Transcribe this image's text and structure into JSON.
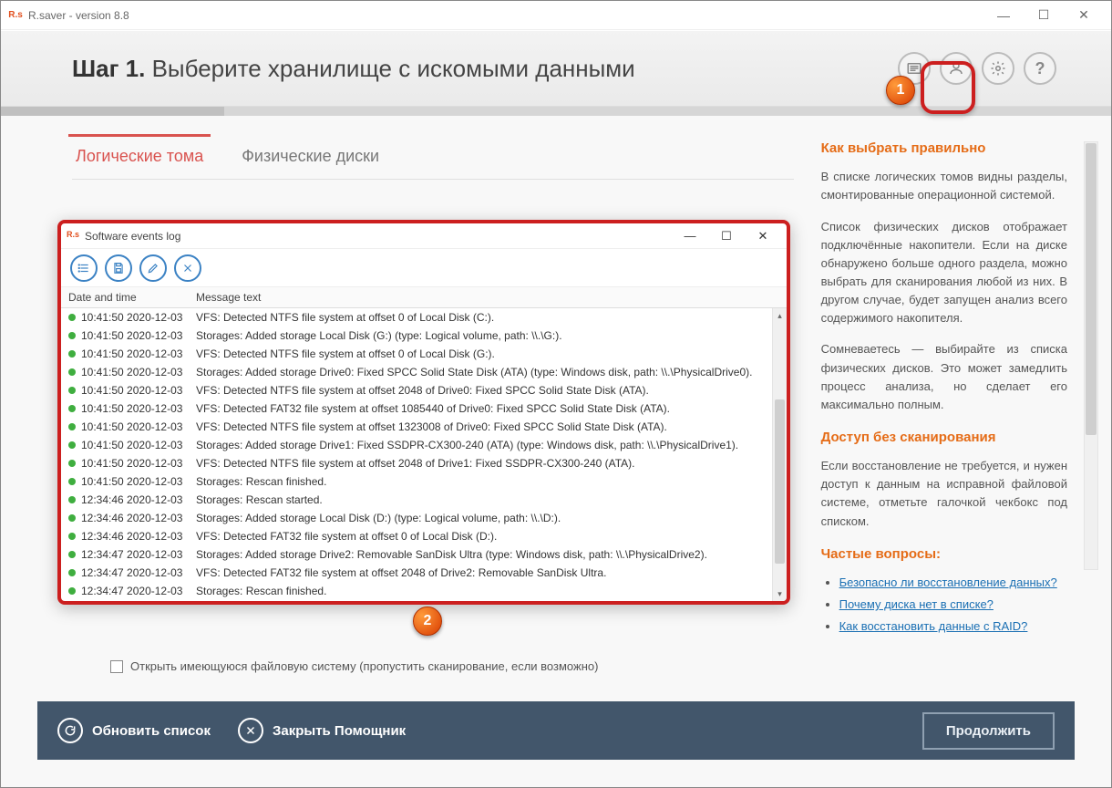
{
  "app": {
    "icon_text": "R.s",
    "title": "R.saver - version 8.8"
  },
  "header": {
    "step_prefix": "Шаг 1.",
    "step_title": "Выберите хранилище с искомыми данными"
  },
  "tabs": {
    "logical": "Логические тома",
    "physical": "Физические диски"
  },
  "log_window": {
    "icon_text": "R.s",
    "title": "Software events log",
    "columns": {
      "time": "Date and time",
      "message": "Message text"
    },
    "rows": [
      {
        "time": "10:41:50 2020-12-03",
        "msg": "VFS: Detected NTFS file system at offset 0 of Local Disk (C:)."
      },
      {
        "time": "10:41:50 2020-12-03",
        "msg": "Storages: Added storage Local Disk (G:) (type: Logical volume, path: \\\\.\\G:)."
      },
      {
        "time": "10:41:50 2020-12-03",
        "msg": "VFS: Detected NTFS file system at offset 0 of Local Disk (G:)."
      },
      {
        "time": "10:41:50 2020-12-03",
        "msg": "Storages: Added storage Drive0: Fixed SPCC Solid State Disk (ATA) (type: Windows disk, path: \\\\.\\PhysicalDrive0)."
      },
      {
        "time": "10:41:50 2020-12-03",
        "msg": "VFS: Detected NTFS file system at offset 2048 of Drive0: Fixed SPCC Solid State Disk (ATA)."
      },
      {
        "time": "10:41:50 2020-12-03",
        "msg": "VFS: Detected FAT32 file system at offset 1085440 of Drive0: Fixed SPCC Solid State Disk (ATA)."
      },
      {
        "time": "10:41:50 2020-12-03",
        "msg": "VFS: Detected NTFS file system at offset 1323008 of Drive0: Fixed SPCC Solid State Disk (ATA)."
      },
      {
        "time": "10:41:50 2020-12-03",
        "msg": "Storages: Added storage Drive1: Fixed SSDPR-CX300-240 (ATA) (type: Windows disk, path: \\\\.\\PhysicalDrive1)."
      },
      {
        "time": "10:41:50 2020-12-03",
        "msg": "VFS: Detected NTFS file system at offset 2048 of Drive1: Fixed SSDPR-CX300-240 (ATA)."
      },
      {
        "time": "10:41:50 2020-12-03",
        "msg": "Storages: Rescan finished."
      },
      {
        "time": "12:34:46 2020-12-03",
        "msg": "Storages: Rescan started."
      },
      {
        "time": "12:34:46 2020-12-03",
        "msg": "Storages: Added storage Local Disk (D:) (type: Logical volume, path: \\\\.\\D:)."
      },
      {
        "time": "12:34:46 2020-12-03",
        "msg": "VFS: Detected FAT32 file system at offset 0 of Local Disk (D:)."
      },
      {
        "time": "12:34:47 2020-12-03",
        "msg": "Storages: Added storage Drive2: Removable SanDisk Ultra (type: Windows disk, path: \\\\.\\PhysicalDrive2)."
      },
      {
        "time": "12:34:47 2020-12-03",
        "msg": "VFS: Detected FAT32 file system at offset 2048 of Drive2: Removable SanDisk Ultra."
      },
      {
        "time": "12:34:47 2020-12-03",
        "msg": "Storages: Rescan finished."
      }
    ]
  },
  "sidebar": {
    "h1": "Как выбрать правильно",
    "p1": "В списке логических томов видны разделы, смонтированные операционной системой.",
    "p2": "Список физических дисков отображает подключённые накопители. Если на диске обнаружено больше одного раздела, можно выбрать для сканирования любой из них. В другом случае, будет запущен анализ всего содержимого накопителя.",
    "p3": "Сомневаетесь — выбирайте из списка физических дисков. Это может замедлить процесс анализа, но сделает его максимально полным.",
    "h2": "Доступ без сканирования",
    "p4": "Если восстановление не требуется, и нужен доступ к данным на исправной файловой системе, отметьте галочкой чекбокс под списком.",
    "h3": "Частые вопросы:",
    "faq": [
      "Безопасно ли восстановление данных?",
      "Почему диска нет в списке?",
      "Как восстановить данные с RAID?"
    ]
  },
  "checkbox": {
    "label": "Открыть имеющуюся файловую систему (пропустить сканирование, если возможно)"
  },
  "footer": {
    "refresh": "Обновить список",
    "close": "Закрыть Помощник",
    "continue": "Продолжить"
  },
  "annotations": {
    "badge1": "1",
    "badge2": "2"
  }
}
